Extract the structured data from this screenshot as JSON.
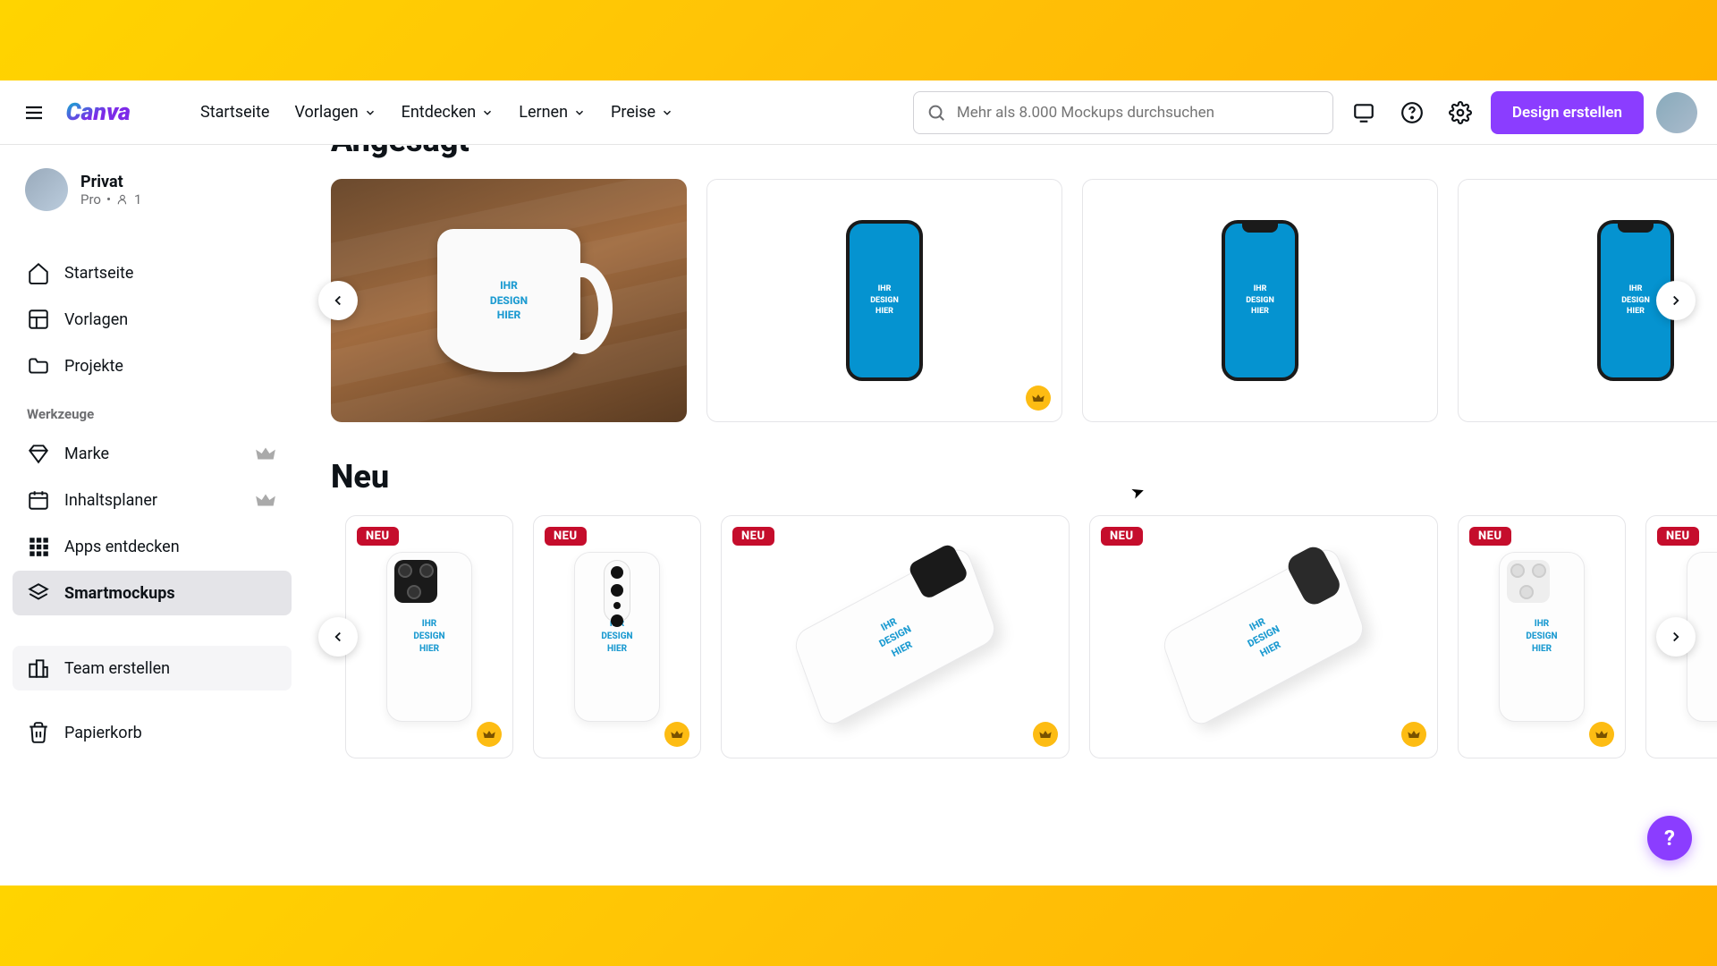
{
  "header": {
    "nav": {
      "home": "Startseite",
      "templates": "Vorlagen",
      "discover": "Entdecken",
      "learn": "Lernen",
      "pricing": "Preise"
    },
    "search_placeholder": "Mehr als 8.000 Mockups durchsuchen",
    "create_button": "Design erstellen"
  },
  "workspace": {
    "name": "Privat",
    "plan": "Pro",
    "members": "1"
  },
  "sidebar": {
    "home": "Startseite",
    "templates": "Vorlagen",
    "projects": "Projekte",
    "tools_section": "Werkzeuge",
    "brand": "Marke",
    "content_planner": "Inhaltsplaner",
    "discover_apps": "Apps entdecken",
    "smartmockups": "Smartmockups",
    "create_team": "Team erstellen",
    "trash": "Papierkorb"
  },
  "sections": {
    "trending": "Angesagt",
    "new": "Neu"
  },
  "mockup_placeholder": "IHR\nDESIGN\nHIER",
  "new_badge": "NEU",
  "help_fab": "?",
  "colors": {
    "primary": "#8b3dff",
    "phone_screen": "#0593d0",
    "phone_text": "#1d9bd1",
    "neu_badge": "#c50d2c",
    "crown": "#fdbc13"
  }
}
